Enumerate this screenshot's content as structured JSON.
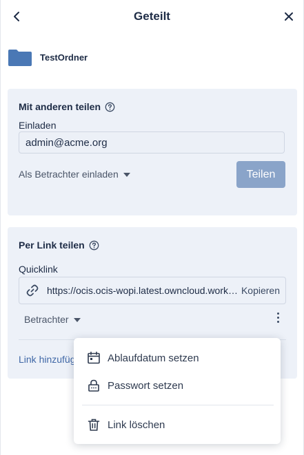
{
  "header": {
    "title": "Geteilt"
  },
  "resource": {
    "name": "TestOrdner"
  },
  "people_share": {
    "title": "Mit anderen teilen",
    "invite_label": "Einladen",
    "invite_value": "admin@acme.org",
    "role": "Als Betrachter einladen",
    "share_button": "Teilen"
  },
  "link_share": {
    "title": "Per Link teilen",
    "quicklink_label": "Quicklink",
    "url": "https://ocis.ocis-wopi.latest.owncloud.works/s/xXyYzZ",
    "copy_label": "Kopieren",
    "role": "Betrachter",
    "add_link_label": "Link hinzufügen"
  },
  "context_menu": {
    "items": [
      {
        "label": "Ablaufdatum setzen",
        "icon": "calendar-icon"
      },
      {
        "label": "Passwort setzen",
        "icon": "lock-icon"
      },
      {
        "label": "Link löschen",
        "icon": "trash-icon"
      }
    ]
  },
  "colors": {
    "panel_bg": "#edf1f8",
    "primary_disabled": "#8aa4c9",
    "folder": "#4a78b5",
    "link": "#3f67a6",
    "text": "#1d2b45"
  }
}
